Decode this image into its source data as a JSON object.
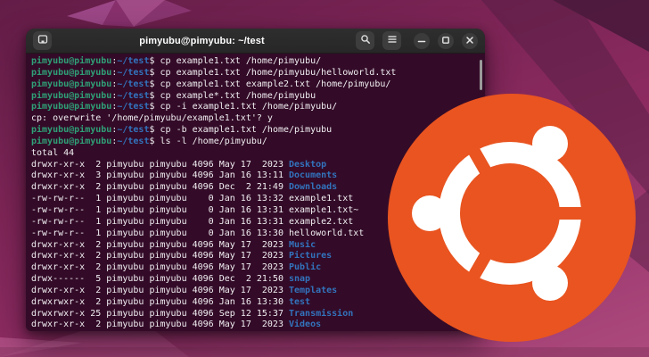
{
  "colors": {
    "accent": "#E95420",
    "terminal_bg": "#330B28",
    "titlebar_bg": "#2A2A2A",
    "button_bg": "#3D3D3D",
    "prompt_green": "#2FA077",
    "path_blue": "#3273BD",
    "text_white": "#F2EFF2",
    "wallpaper_base": "#7B2455"
  },
  "window": {
    "title": "pimyubu@pimyubu: ~/test"
  },
  "icons": {
    "new_tab": "new-tab-icon",
    "search": "search-icon",
    "menu": "menu-icon",
    "minimize": "minimize-icon",
    "maximize": "maximize-icon",
    "close": "close-icon",
    "logo": "ubuntu-circle-of-friends"
  },
  "terminal": {
    "lines": [
      [
        [
          "g",
          "pimyubu@pimyubu"
        ],
        [
          "w",
          ":"
        ],
        [
          "b",
          "~/test"
        ],
        [
          "w",
          "$ cp example1.txt /home/pimyubu/"
        ]
      ],
      [
        [
          "g",
          "pimyubu@pimyubu"
        ],
        [
          "w",
          ":"
        ],
        [
          "b",
          "~/test"
        ],
        [
          "w",
          "$ cp example1.txt /home/pimyubu/helloworld.txt"
        ]
      ],
      [
        [
          "g",
          "pimyubu@pimyubu"
        ],
        [
          "w",
          ":"
        ],
        [
          "b",
          "~/test"
        ],
        [
          "w",
          "$ cp example1.txt example2.txt /home/pimyubu/"
        ]
      ],
      [
        [
          "g",
          "pimyubu@pimyubu"
        ],
        [
          "w",
          ":"
        ],
        [
          "b",
          "~/test"
        ],
        [
          "w",
          "$ cp example*.txt /home/pimyubu"
        ]
      ],
      [
        [
          "g",
          "pimyubu@pimyubu"
        ],
        [
          "w",
          ":"
        ],
        [
          "b",
          "~/test"
        ],
        [
          "w",
          "$ cp -i example1.txt /home/pimyubu/"
        ]
      ],
      [
        [
          "w",
          "cp: overwrite '/home/pimyubu/example1.txt'? y"
        ]
      ],
      [
        [
          "g",
          "pimyubu@pimyubu"
        ],
        [
          "w",
          ":"
        ],
        [
          "b",
          "~/test"
        ],
        [
          "w",
          "$ cp -b example1.txt /home/pimyubu"
        ]
      ],
      [
        [
          "g",
          "pimyubu@pimyubu"
        ],
        [
          "w",
          ":"
        ],
        [
          "b",
          "~/test"
        ],
        [
          "w",
          "$ ls -l /home/pimyubu/"
        ]
      ],
      [
        [
          "w",
          "total 44"
        ]
      ],
      [
        [
          "w",
          "drwxr-xr-x  2 pimyubu pimyubu 4096 May 17  2023 "
        ],
        [
          "b",
          "Desktop"
        ]
      ],
      [
        [
          "w",
          "drwxr-xr-x  3 pimyubu pimyubu 4096 Jan 16 13:11 "
        ],
        [
          "b",
          "Documents"
        ]
      ],
      [
        [
          "w",
          "drwxr-xr-x  2 pimyubu pimyubu 4096 Dec  2 21:49 "
        ],
        [
          "b",
          "Downloads"
        ]
      ],
      [
        [
          "w",
          "-rw-rw-r--  1 pimyubu pimyubu    0 Jan 16 13:32 example1.txt"
        ]
      ],
      [
        [
          "w",
          "-rw-rw-r--  1 pimyubu pimyubu    0 Jan 16 13:31 example1.txt~"
        ]
      ],
      [
        [
          "w",
          "-rw-rw-r--  1 pimyubu pimyubu    0 Jan 16 13:31 example2.txt"
        ]
      ],
      [
        [
          "w",
          "-rw-rw-r--  1 pimyubu pimyubu    0 Jan 16 13:30 helloworld.txt"
        ]
      ],
      [
        [
          "w",
          "drwxr-xr-x  2 pimyubu pimyubu 4096 May 17  2023 "
        ],
        [
          "b",
          "Music"
        ]
      ],
      [
        [
          "w",
          "drwxr-xr-x  2 pimyubu pimyubu 4096 May 17  2023 "
        ],
        [
          "b",
          "Pictures"
        ]
      ],
      [
        [
          "w",
          "drwxr-xr-x  2 pimyubu pimyubu 4096 May 17  2023 "
        ],
        [
          "b",
          "Public"
        ]
      ],
      [
        [
          "w",
          "drwx------  5 pimyubu pimyubu 4096 Dec  2 21:50 "
        ],
        [
          "b",
          "snap"
        ]
      ],
      [
        [
          "w",
          "drwxr-xr-x  2 pimyubu pimyubu 4096 May 17  2023 "
        ],
        [
          "b",
          "Templates"
        ]
      ],
      [
        [
          "w",
          "drwxrwxr-x  2 pimyubu pimyubu 4096 Jan 16 13:30 "
        ],
        [
          "b",
          "test"
        ]
      ],
      [
        [
          "w",
          "drwxrwxr-x 25 pimyubu pimyubu 4096 Sep 12 15:37 "
        ],
        [
          "b",
          "Transmission"
        ]
      ],
      [
        [
          "w",
          "drwxr-xr-x  2 pimyubu pimyubu 4096 May 17  2023 "
        ],
        [
          "b",
          "Videos"
        ]
      ]
    ]
  }
}
